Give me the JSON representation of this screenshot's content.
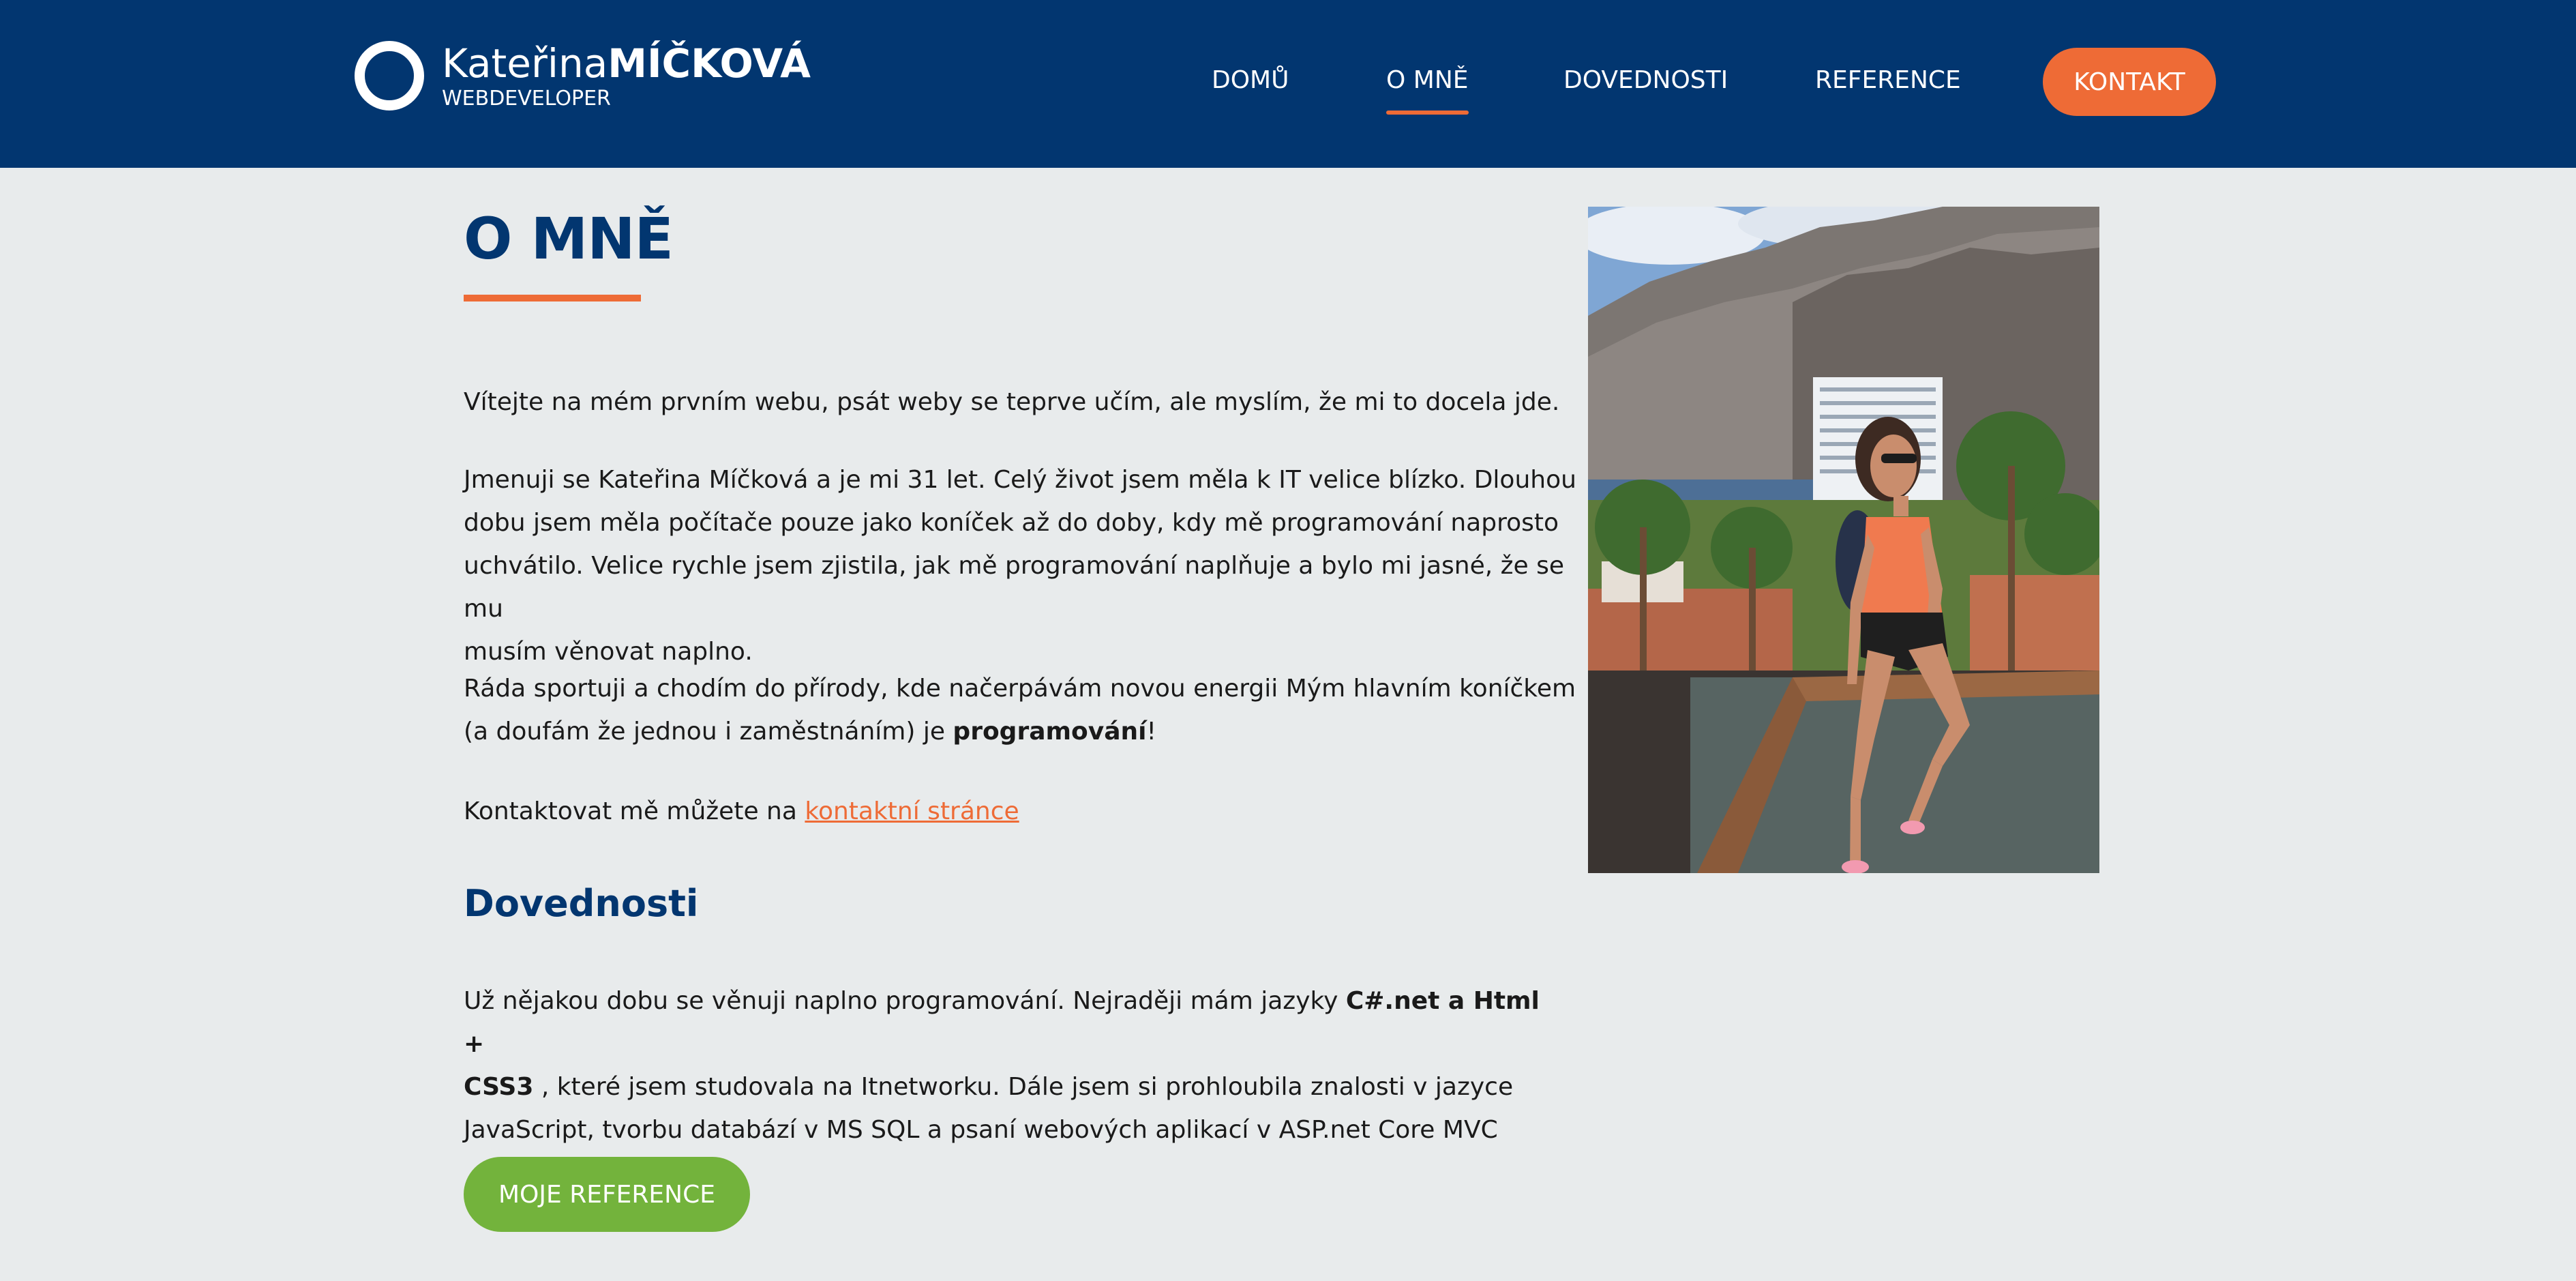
{
  "header": {
    "logo": {
      "first_name": "Kateřina",
      "last_name": "MÍČKOVÁ",
      "subtitle": "WEBDEVELOPER"
    },
    "nav": [
      {
        "label": "DOMŮ",
        "active": false
      },
      {
        "label": "O MNĚ",
        "active": true
      },
      {
        "label": "DOVEDNOSTI",
        "active": false
      },
      {
        "label": "REFERENCE",
        "active": false
      }
    ],
    "contact_label": "KONTAKT"
  },
  "main": {
    "title": "O MNĚ",
    "paragraphs": {
      "p1": "Vítejte na mém prvním webu, psát weby se teprve učím, ale myslím, že mi to docela jde.",
      "p2_line1": "Jmenuji se Kateřina Míčková a je mi 31 let. Celý život jsem měla k IT velice blízko. Dlouhou",
      "p2_line2": "dobu jsem měla počítače pouze jako koníček až do doby, kdy mě programování naprosto",
      "p2_line3": "uchvátilo. Velice rychle jsem zjistila, jak mě programování naplňuje a bylo mi jasné, že se mu",
      "p2_line4": "musím věnovat naplno.",
      "p3_line1": "Ráda sportuji a chodím do přírody, kde načerpávám novou energii Mým hlavním koníčkem",
      "p3_line2_pre": "(a doufám že jednou i zaměstnáním) je ",
      "p3_bold": "programování",
      "p3_post": "!",
      "p4_pre": "Kontaktovat mě můžete na ",
      "p4_link": "kontaktní stránce"
    },
    "skills": {
      "title": "Dovednosti",
      "line1_pre": "Už nějakou dobu se věnuji naplno programování. Nejraději mám jazyky ",
      "line1_bold": "C#.net a Html +",
      "line2_bold": "CSS3",
      "line2_post": " , které jsem studovala na Itnetworku. Dále jsem si prohloubila znalosti v jazyce",
      "line3": "JavaScript, tvorbu databází v MS SQL a psaní webových aplikací v ASP.net Core MVC"
    },
    "references_button": "MOJE REFERENCE"
  },
  "colors": {
    "header_bg": "#023670",
    "accent": "#ee6b36",
    "button_green": "#73b33c",
    "page_bg": "#e8ebec"
  }
}
